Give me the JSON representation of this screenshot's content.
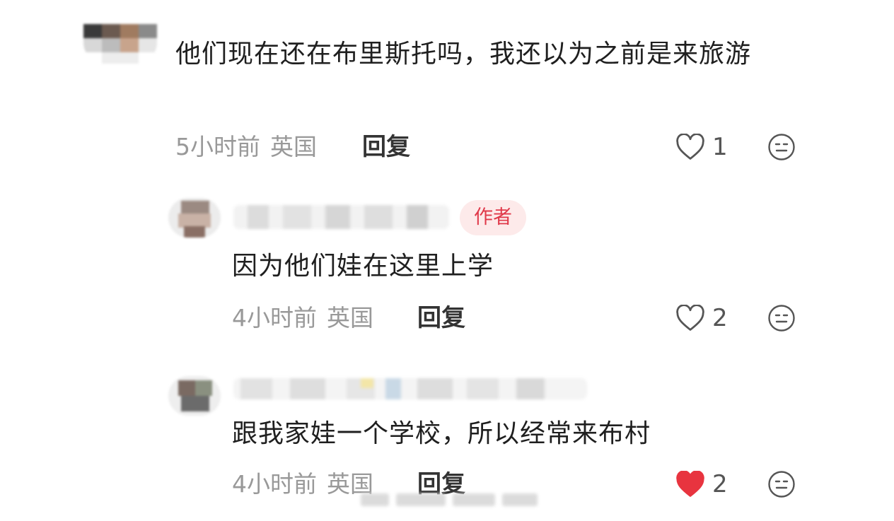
{
  "comments": [
    {
      "text": "他们现在还在布里斯托吗，我还以为之前是来旅游",
      "time": "5小时前",
      "location": "英国",
      "reply_label": "回复",
      "likes": "1",
      "liked": false
    },
    {
      "author_badge": "作者",
      "text": "因为他们娃在这里上学",
      "time": "4小时前",
      "location": "英国",
      "reply_label": "回复",
      "likes": "2",
      "liked": false
    },
    {
      "text": "跟我家娃一个学校，所以经常来布村",
      "time": "4小时前",
      "location": "英国",
      "reply_label": "回复",
      "likes": "2",
      "liked": true
    }
  ],
  "icons": {
    "like": "heart-outline-icon",
    "liked": "heart-filled-icon",
    "dislike": "neutral-face-icon"
  },
  "colors": {
    "liked_heart": "#e8343f",
    "author_badge_bg": "#fdeaea",
    "author_badge_text": "#e0394a",
    "meta_text": "#999999"
  }
}
